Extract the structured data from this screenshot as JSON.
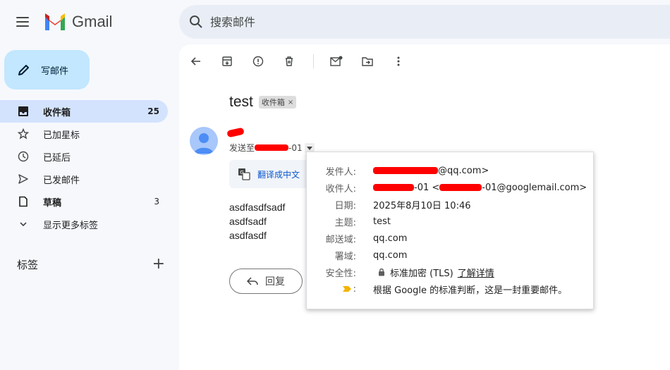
{
  "app": {
    "name": "Gmail",
    "search_placeholder": "搜索邮件"
  },
  "compose": {
    "label": "写邮件"
  },
  "sidebar": {
    "items": [
      {
        "label": "收件箱",
        "count": "25",
        "icon": "inbox-icon",
        "active": true
      },
      {
        "label": "已加星标",
        "count": "",
        "icon": "star-icon"
      },
      {
        "label": "已延后",
        "count": "",
        "icon": "clock-icon"
      },
      {
        "label": "已发邮件",
        "count": "",
        "icon": "send-icon"
      },
      {
        "label": "草稿",
        "count": "3",
        "icon": "draft-icon"
      },
      {
        "label": "显示更多标签",
        "count": "",
        "icon": "chevron-down-icon"
      }
    ],
    "labels_heading": "标签"
  },
  "email": {
    "subject": "test",
    "label_chip": "收件箱",
    "to_prefix": "发送至",
    "to_suffix": "-01",
    "translate_label": "翻译成中文",
    "body_lines": [
      "asdfasdfsadf",
      "asdfsadf",
      "asdfasdf"
    ],
    "reply_label": "回复"
  },
  "details": {
    "from_key": "发件人:",
    "from_val": "@qq.com>",
    "to_key": "收件人:",
    "to_val_a": "-01 <",
    "to_val_b": "-01@googlemail.com>",
    "date_key": "日期:",
    "date_val": "2025年8月10日 10:46",
    "subject_key": "主题:",
    "subject_val": "test",
    "mailedby_key": "邮送域:",
    "mailedby_val": "qq.com",
    "signedby_key": "署域:",
    "signedby_val": "qq.com",
    "security_key": "安全性:",
    "security_val": "标准加密 (TLS)",
    "security_link": "了解详情",
    "importance_key": ":",
    "importance_val": "根据 Google 的标准判断，这是一封重要邮件。"
  },
  "colors": {
    "accent": "#0b57d0",
    "compose_bg": "#c2e7ff",
    "nav_active": "#d3e3fd",
    "redaction": "#ff0000",
    "importance": "#f4b400"
  }
}
